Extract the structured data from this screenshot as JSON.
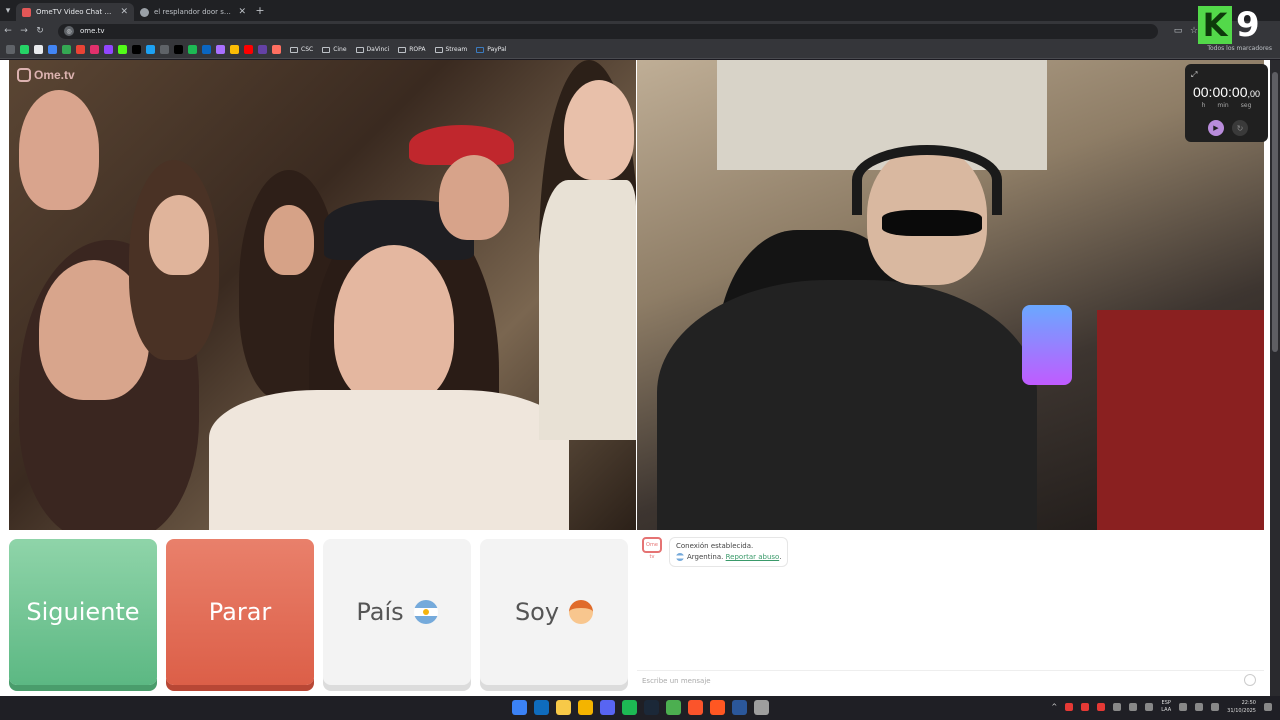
{
  "browser": {
    "tabs": [
      {
        "title": "OmeTV Video Chat — Ome",
        "active": true,
        "favicon_color": "#e35757"
      },
      {
        "title": "el resplandor door scene - Bus",
        "active": false,
        "favicon_color": "#9aa0a6"
      }
    ],
    "new_tab": "+",
    "url": "ome.tv",
    "bookmark_folders": [
      "CSC",
      "Cine",
      "DaVinci",
      "ROPA",
      "Stream",
      "PayPal"
    ],
    "all_bookmarks": "Todos los marcadores",
    "bookmark_icon_colors": [
      "#25d366",
      "#e8eaed",
      "#4285f4",
      "#34a853",
      "#ea4335",
      "#e1306c",
      "#9146ff",
      "#53fc18",
      "#000000",
      "#1da1f2",
      "#5f6368",
      "#000000",
      "#1db954",
      "#0a66c2",
      "#a970ff",
      "#fbbc04",
      "#ff0000",
      "#6441a5",
      "#ff6f61"
    ]
  },
  "overlay_logo": {
    "k": "K",
    "n": "9"
  },
  "ome_logo": "Ome.tv",
  "timer": {
    "value": "00:00:00",
    "fraction": ",00",
    "units": [
      "h",
      "min",
      "seg"
    ]
  },
  "buttons": {
    "next": "Siguiente",
    "stop": "Parar",
    "country": "País",
    "gender": "Soy"
  },
  "chat": {
    "avatar": "Ome tv",
    "message_line1": "Conexión establecida.",
    "country": "Argentina.",
    "report_link": "Reportar abuso",
    "input_placeholder": "Escribe un mensaje"
  },
  "taskbar": {
    "lang": "ESP",
    "lang2": "LAA",
    "time": "22:50",
    "date": "31/10/2025",
    "app_colors": [
      "#3b82f6",
      "#0f6cbd",
      "#f7c948",
      "#f4b400",
      "#5865f2",
      "#1db954",
      "#1b2838",
      "#4caf50",
      "#fb542b",
      "#ff5722",
      "#2b579a",
      "#9e9e9e"
    ]
  }
}
